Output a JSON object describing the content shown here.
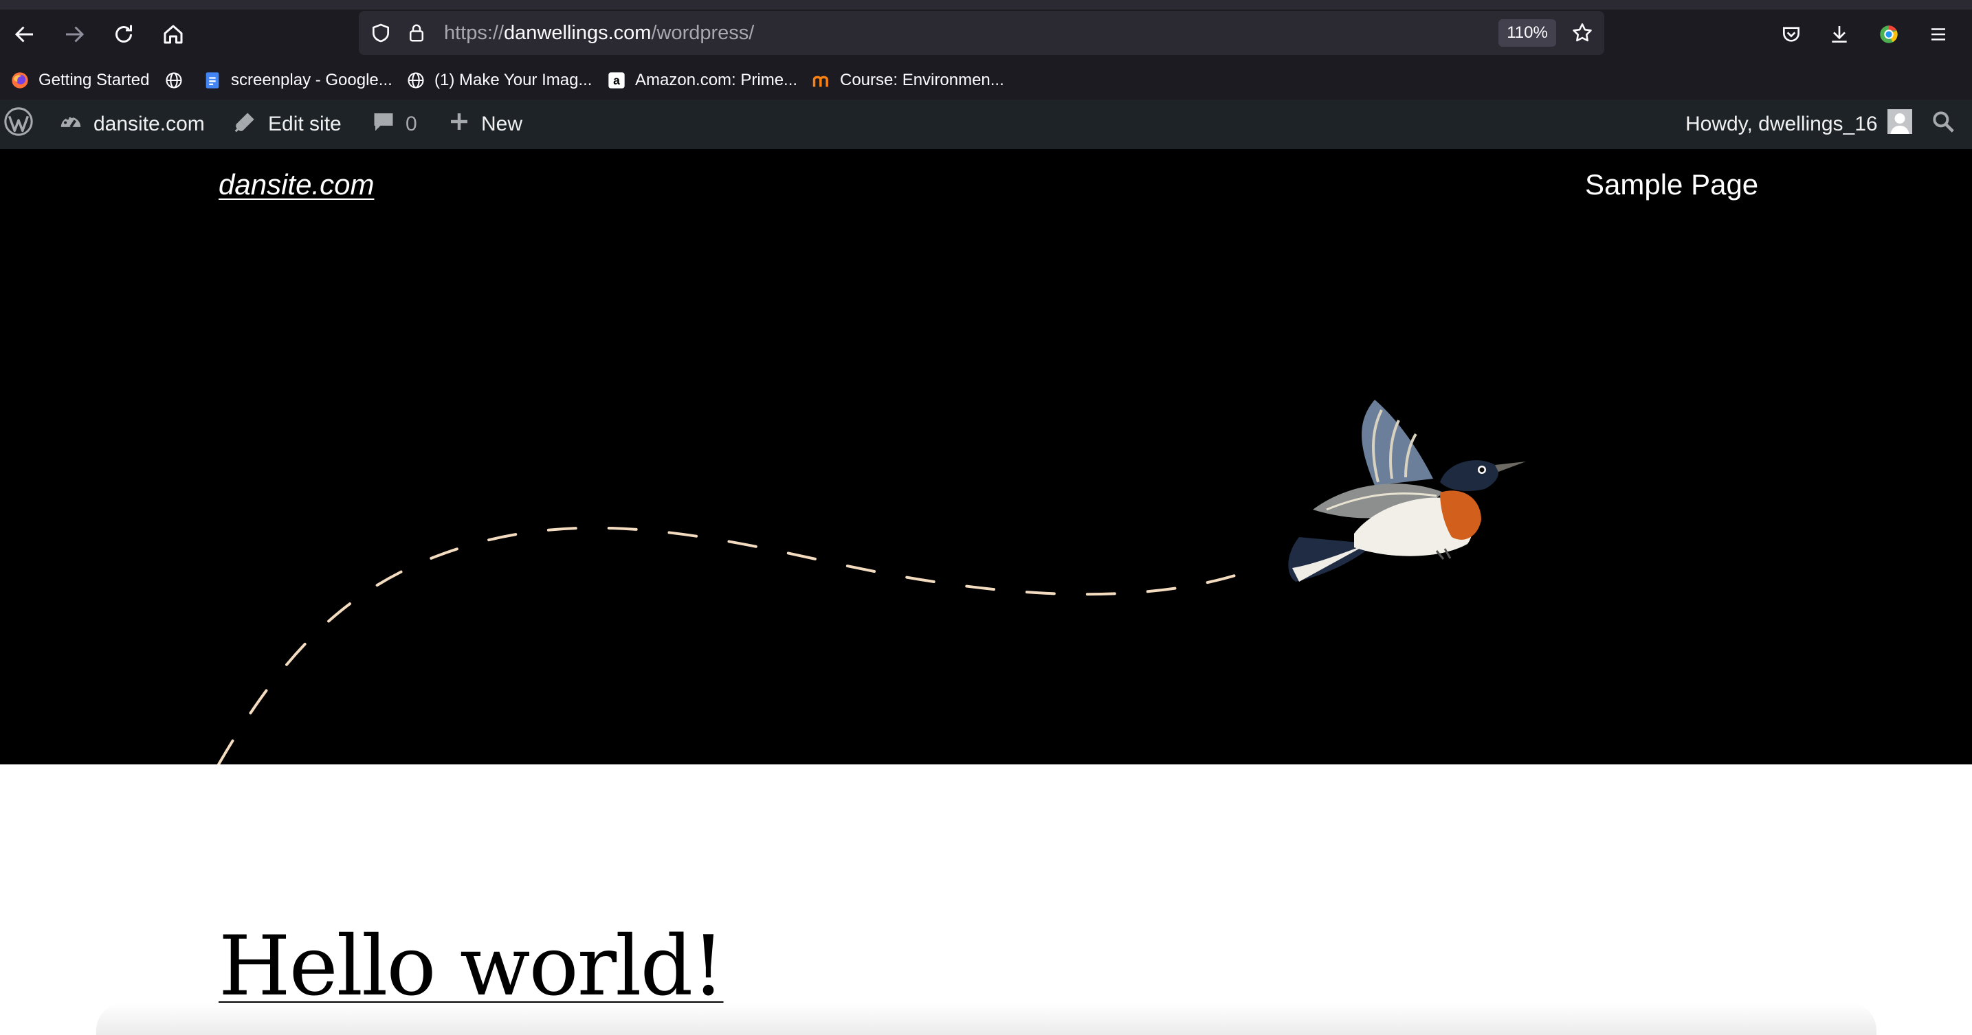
{
  "browser": {
    "url_scheme": "https://",
    "url_host": "danwellings.com",
    "url_path": "/wordpress/",
    "zoom": "110%",
    "bookmarks": [
      {
        "label": "Getting Started",
        "icon": "firefox-icon"
      },
      {
        "label": "",
        "icon": "globe-icon"
      },
      {
        "label": "screenplay - Google...",
        "icon": "google-docs-icon"
      },
      {
        "label": "(1) Make Your Imag...",
        "icon": "globe-icon"
      },
      {
        "label": "Amazon.com: Prime...",
        "icon": "amazon-icon"
      },
      {
        "label": "Course: Environmen...",
        "icon": "moodle-icon"
      }
    ]
  },
  "adminbar": {
    "site_name": "dansite.com",
    "edit_site": "Edit site",
    "comments_count": "0",
    "new_label": "New",
    "howdy": "Howdy, dwellings_16"
  },
  "site": {
    "title": "dansite.com",
    "nav": [
      "Sample Page"
    ]
  },
  "post": {
    "title": "Hello world!"
  },
  "colors": {
    "chrome_bg": "#1c1b22",
    "urlbar_bg": "#2b2a33",
    "adminbar_bg": "#1d2327",
    "hero_bg": "#000000",
    "dash_color": "#f4dcc0"
  }
}
